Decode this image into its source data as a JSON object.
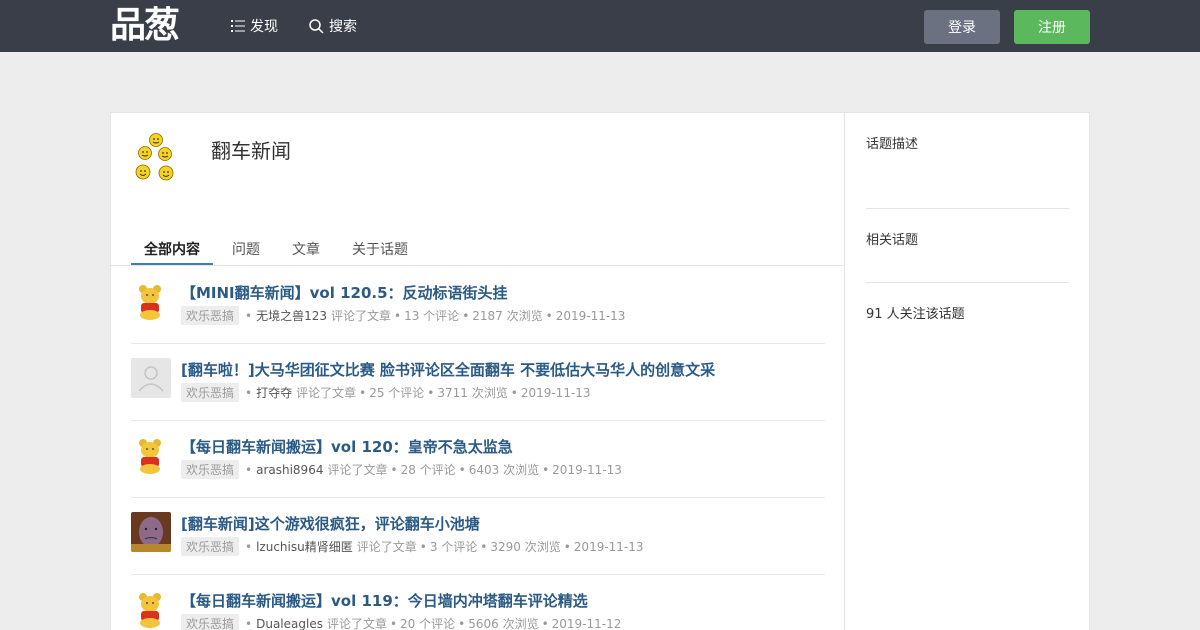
{
  "header": {
    "logo": "品葱",
    "nav": [
      {
        "label": "发现",
        "icon": "list-icon"
      },
      {
        "label": "搜索",
        "icon": "search-icon"
      }
    ],
    "login_label": "登录",
    "register_label": "注册",
    "colors": {
      "bar": "#3a3e48",
      "login": "#6b7180",
      "register": "#5cb85c"
    }
  },
  "topic": {
    "title": "翻车新闻",
    "avatar_icon": "emoji-faces-icon"
  },
  "tabs": [
    {
      "label": "全部内容",
      "active": true
    },
    {
      "label": "问题",
      "active": false
    },
    {
      "label": "文章",
      "active": false
    },
    {
      "label": "关于话题",
      "active": false
    }
  ],
  "feed": [
    {
      "title": "【MINI翻车新闻】vol 120.5：反动标语街头挂",
      "tag": "欢乐恶搞",
      "user": "无境之兽123",
      "action": "评论了文章",
      "comments": "13 个评论",
      "views": "2187 次浏览",
      "date": "2019-11-13",
      "avatar": "pooh-avatar-icon"
    },
    {
      "title": "[翻车啦！]大马华团征文比赛 脸书评论区全面翻车 不要低估大马华人的创意文采",
      "tag": "欢乐恶搞",
      "user": "打夺夺",
      "action": "评论了文章",
      "comments": "25 个评论",
      "views": "3711 次浏览",
      "date": "2019-11-13",
      "avatar": "default-user-avatar-icon"
    },
    {
      "title": "【每日翻车新闻搬运】vol 120：皇帝不急太监急",
      "tag": "欢乐恶搞",
      "user": "arashi8964",
      "action": "评论了文章",
      "comments": "28 个评论",
      "views": "6403 次浏览",
      "date": "2019-11-13",
      "avatar": "pooh-avatar-icon"
    },
    {
      "title": "[翻车新闻]这个游戏很疯狂，评论翻车小池塘",
      "tag": "欢乐恶搞",
      "user": "lzuchisu精肾细匿",
      "action": "评论了文章",
      "comments": "3 个评论",
      "views": "3290 次浏览",
      "date": "2019-11-13",
      "avatar": "thanos-avatar-icon"
    },
    {
      "title": "【每日翻车新闻搬运】vol 119：今日墙内冲塔翻车评论精选",
      "tag": "欢乐恶搞",
      "user": "Dualeagles",
      "action": "评论了文章",
      "comments": "20 个评论",
      "views": "5606 次浏览",
      "date": "2019-11-12",
      "avatar": "pooh-avatar-icon"
    }
  ],
  "sidebar": {
    "description_label": "话题描述",
    "related_label": "相关话题",
    "followers_text": "91 人关注该话题"
  }
}
